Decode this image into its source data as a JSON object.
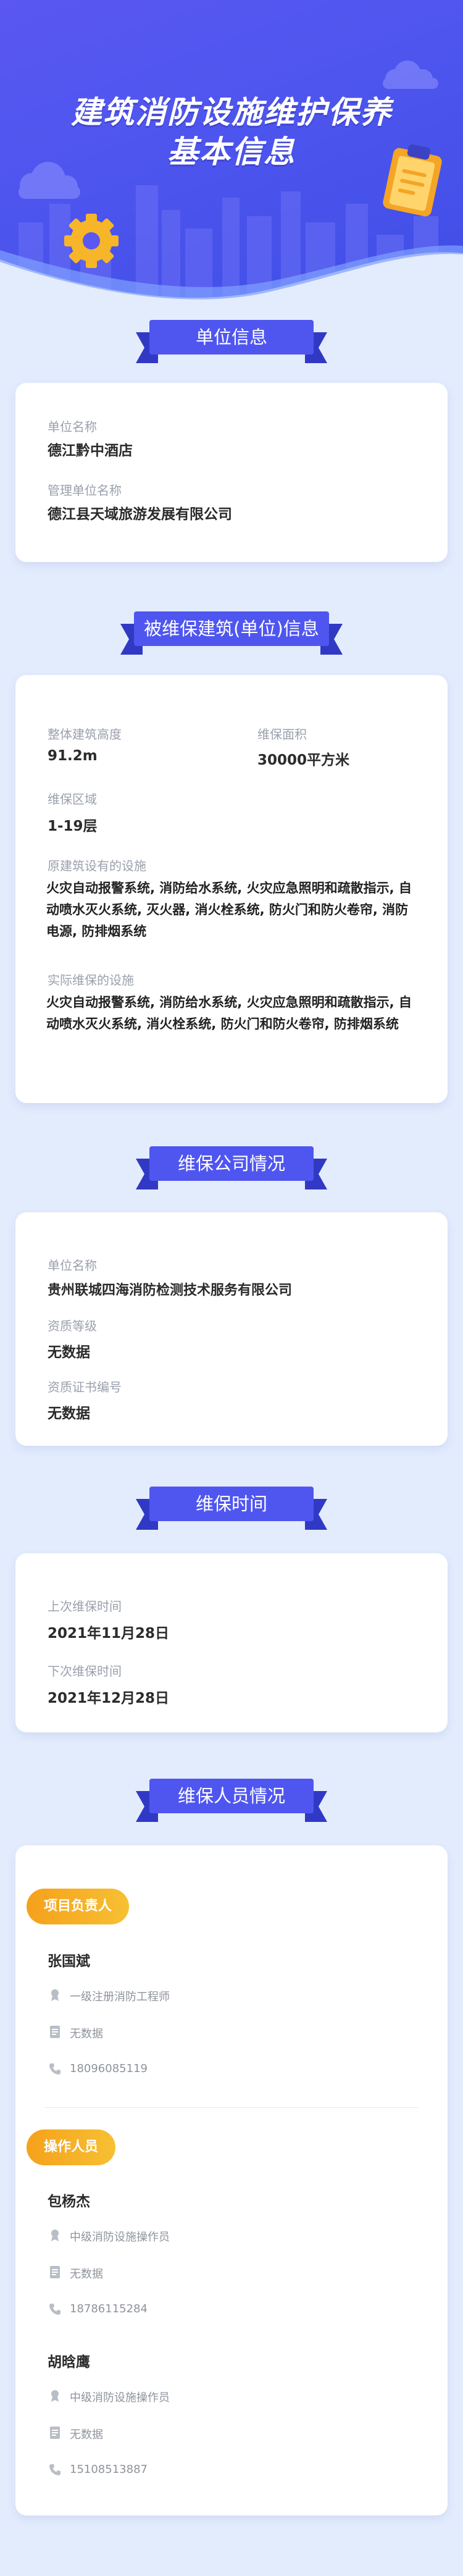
{
  "header": {
    "title_line1": "建筑消防设施维护保养",
    "title_line2": "基本信息"
  },
  "sections": {
    "unit_info": "单位信息",
    "building_info": "被维保建筑(单位)信息",
    "company_info": "维保公司情况",
    "maintenance_time": "维保时间",
    "personnel": "维保人员情况"
  },
  "unit": {
    "name_label": "单位名称",
    "name_value": "德江黔中酒店",
    "manager_label": "管理单位名称",
    "manager_value": "德江县天域旅游发展有限公司"
  },
  "building": {
    "height_label": "整体建筑高度",
    "height_value": "91.2m",
    "area_label": "维保面积",
    "area_value": "30000平方米",
    "scope_label": "维保区域",
    "scope_value": "1-19层",
    "original_label": "原建筑设有的设施",
    "original_value": "火灾自动报警系统, 消防给水系统, 火灾应急照明和疏散指示, 自动喷水灭火系统, 灭火器, 消火栓系统, 防火门和防火卷帘, 消防电源, 防排烟系统",
    "actual_label": "实际维保的设施",
    "actual_value": "火灾自动报警系统, 消防给水系统, 火灾应急照明和疏散指示, 自动喷水灭火系统, 消火栓系统, 防火门和防火卷帘, 防排烟系统"
  },
  "company": {
    "name_label": "单位名称",
    "name_value": "贵州联城四海消防检测技术服务有限公司",
    "grade_label": "资质等级",
    "grade_value": "无数据",
    "cert_label": "资质证书编号",
    "cert_value": "无数据"
  },
  "time": {
    "last_label": "上次维保时间",
    "last_value": "2021年11月28日",
    "next_label": "下次维保时间",
    "next_value": "2021年12月28日"
  },
  "personnel": {
    "leader_tag": "项目负责人",
    "leader": {
      "name": "张国斌",
      "cert": "一级注册消防工程师",
      "doc": "无数据",
      "phone": "18096085119"
    },
    "operator_tag": "操作人员",
    "operators": [
      {
        "name": "包杨杰",
        "cert": "中级消防设施操作员",
        "doc": "无数据",
        "phone": "18786115284"
      },
      {
        "name": "胡晗鹰",
        "cert": "中级消防设施操作员",
        "doc": "无数据",
        "phone": "15108513887"
      }
    ]
  },
  "colors": {
    "primary": "#4d55ee",
    "badge": "#4f56f0",
    "accent_orange": "#f5a11b",
    "page_bg": "#e3ecfd",
    "icon_gear": "#f7b52a",
    "icon_clipboard": "#f4a526"
  },
  "icons": {
    "cert": "medal-icon",
    "doc": "document-icon",
    "phone": "phone-icon"
  }
}
